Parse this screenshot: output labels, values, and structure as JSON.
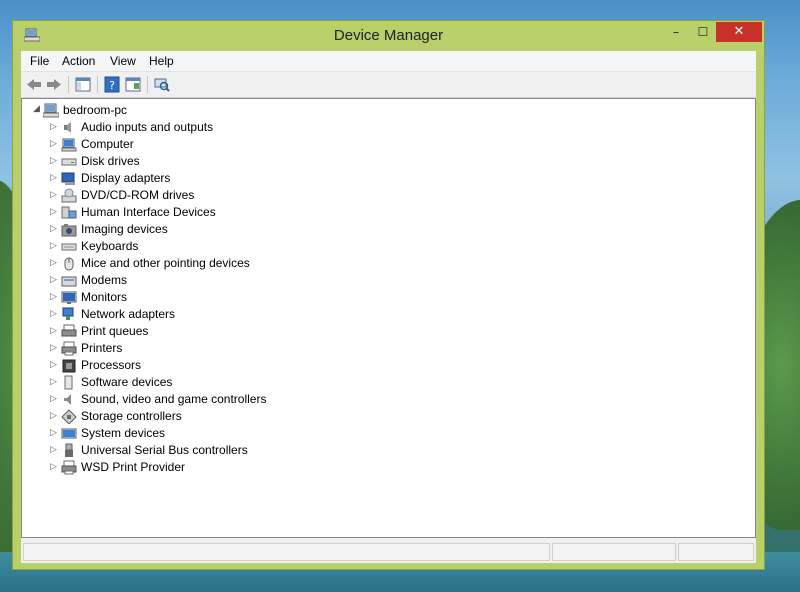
{
  "window": {
    "title": "Device Manager",
    "controls": {
      "minimize": "–",
      "maximize": "☐",
      "close": "✕"
    }
  },
  "menu": {
    "items": [
      "File",
      "Action",
      "View",
      "Help"
    ]
  },
  "toolbar": {
    "buttons": [
      "back-icon",
      "forward-icon",
      "show-hide-console-tree-icon",
      "help-icon",
      "properties-icon",
      "scan-hardware-icon"
    ]
  },
  "tree": {
    "root": {
      "label": "bedroom-pc",
      "expanded": true
    },
    "items": [
      {
        "label": "Audio inputs and outputs",
        "icon": "speaker-icon"
      },
      {
        "label": "Computer",
        "icon": "computer-icon"
      },
      {
        "label": "Disk drives",
        "icon": "disk-drive-icon"
      },
      {
        "label": "Display adapters",
        "icon": "display-adapter-icon"
      },
      {
        "label": "DVD/CD-ROM drives",
        "icon": "dvd-drive-icon"
      },
      {
        "label": "Human Interface Devices",
        "icon": "hid-icon"
      },
      {
        "label": "Imaging devices",
        "icon": "camera-icon"
      },
      {
        "label": "Keyboards",
        "icon": "keyboard-icon"
      },
      {
        "label": "Mice and other pointing devices",
        "icon": "mouse-icon"
      },
      {
        "label": "Modems",
        "icon": "modem-icon"
      },
      {
        "label": "Monitors",
        "icon": "monitor-icon"
      },
      {
        "label": "Network adapters",
        "icon": "network-adapter-icon"
      },
      {
        "label": "Print queues",
        "icon": "print-queue-icon"
      },
      {
        "label": "Printers",
        "icon": "printer-icon"
      },
      {
        "label": "Processors",
        "icon": "processor-icon"
      },
      {
        "label": "Software devices",
        "icon": "software-device-icon"
      },
      {
        "label": "Sound, video and game controllers",
        "icon": "sound-icon"
      },
      {
        "label": "Storage controllers",
        "icon": "storage-controller-icon"
      },
      {
        "label": "System devices",
        "icon": "system-device-icon"
      },
      {
        "label": "Universal Serial Bus controllers",
        "icon": "usb-icon"
      },
      {
        "label": "WSD Print Provider",
        "icon": "wsd-printer-icon"
      }
    ]
  },
  "colors": {
    "window_frame": "#b8cf6a",
    "close_button": "#c7312a",
    "tree_background": "#ffffff"
  }
}
